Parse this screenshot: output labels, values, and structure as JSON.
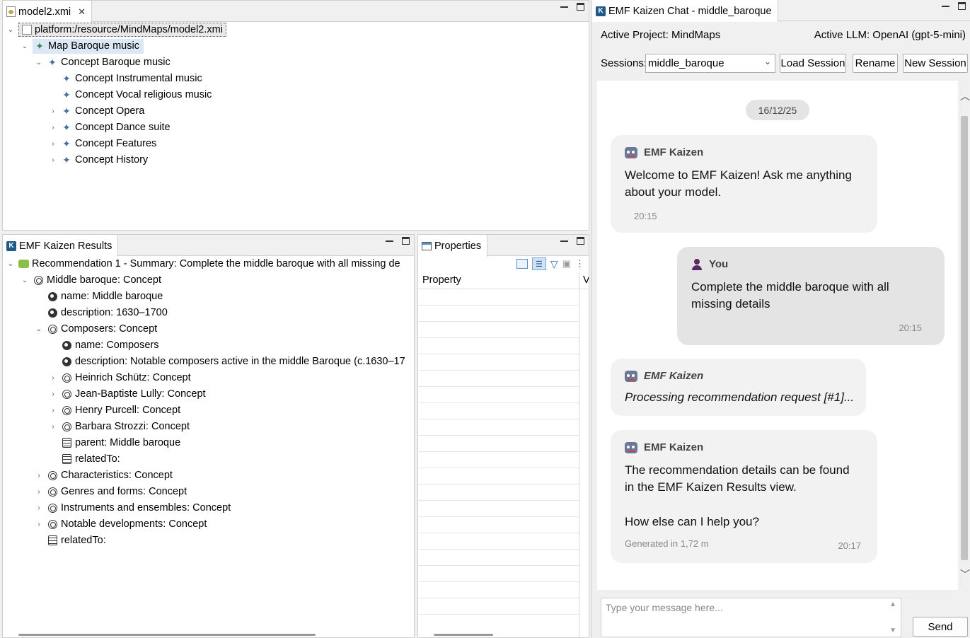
{
  "editor": {
    "tab_title": "model2.xmi",
    "tree": [
      {
        "label": "platform:/resource/MindMaps/model2.xmi"
      },
      {
        "label": "Map Baroque music"
      },
      {
        "label": "Concept Baroque music"
      },
      {
        "label": "Concept Instrumental music"
      },
      {
        "label": "Concept Vocal religious music"
      },
      {
        "label": "Concept Opera"
      },
      {
        "label": "Concept Dance suite"
      },
      {
        "label": "Concept Features"
      },
      {
        "label": "Concept History"
      }
    ]
  },
  "results": {
    "tab_title": "EMF Kaizen Results",
    "tree": [
      {
        "label": "Recommendation 1 - Summary: Complete the middle baroque with all missing de"
      },
      {
        "label": "Middle baroque: Concept"
      },
      {
        "label": "name: Middle baroque"
      },
      {
        "label": "description: 1630–1700"
      },
      {
        "label": "Composers: Concept"
      },
      {
        "label": "name: Composers"
      },
      {
        "label": "description: Notable composers active in the middle Baroque (c.1630–17"
      },
      {
        "label": "Heinrich Schütz: Concept"
      },
      {
        "label": "Jean-Baptiste Lully: Concept"
      },
      {
        "label": "Henry Purcell: Concept"
      },
      {
        "label": "Barbara Strozzi: Concept"
      },
      {
        "label": "parent: Middle baroque"
      },
      {
        "label": "relatedTo:"
      },
      {
        "label": "Characteristics: Concept"
      },
      {
        "label": "Genres and forms: Concept"
      },
      {
        "label": "Instruments and ensembles: Concept"
      },
      {
        "label": "Notable developments: Concept"
      },
      {
        "label": "relatedTo:"
      }
    ]
  },
  "properties": {
    "tab_title": "Properties",
    "col_property": "Property",
    "col_value": "V"
  },
  "chat": {
    "tab_title": "EMF Kaizen Chat - middle_baroque",
    "active_project": "Active Project: MindMaps",
    "active_llm": "Active LLM: OpenAI (gpt-5-mini)",
    "sessions_label": "Sessions:",
    "session_value": "middle_baroque",
    "load_session": "Load Session",
    "rename": "Rename",
    "new_session": "New Session",
    "date": "16/12/25",
    "messages": [
      {
        "sender": "EMF Kaizen",
        "line1": "Welcome to EMF Kaizen! Ask me anything",
        "line2": "about your model.",
        "time": "20:15"
      },
      {
        "sender": "You",
        "line1": "Complete the middle baroque with all",
        "line2": "missing details",
        "time": "20:15"
      },
      {
        "sender": "EMF Kaizen",
        "line1": "Processing recommendation request [#1]..."
      },
      {
        "sender": "EMF Kaizen",
        "line1": "The recommendation details can be found",
        "line2": "in the EMF Kaizen Results view.",
        "line3": "How else can I help you?",
        "generated": "Generated in 1,72 m",
        "time": "20:17"
      }
    ],
    "input_placeholder": "Type your message here...",
    "send": "Send"
  }
}
